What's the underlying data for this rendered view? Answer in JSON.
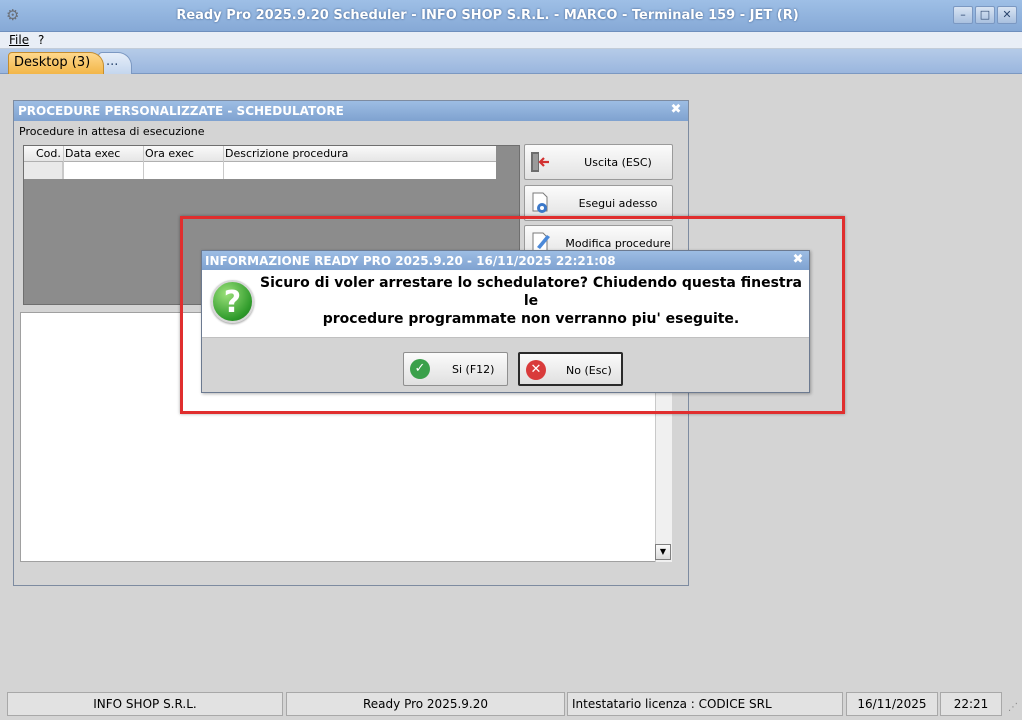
{
  "app": {
    "title": "Ready Pro 2025.9.20 Scheduler  - INFO SHOP S.R.L. - MARCO - Terminale 159 - JET (R)",
    "icon": "gear-icon"
  },
  "window_controls": {
    "minimize": "–",
    "maximize": "□",
    "close": "✕"
  },
  "menu": {
    "items": [
      "File",
      "?"
    ]
  },
  "tabs": [
    {
      "label": "Desktop (3)"
    },
    {
      "label": "..."
    }
  ],
  "procedures_window": {
    "title": "PROCEDURE PERSONALIZZATE - SCHEDULATORE",
    "close": "✖",
    "caption": "Procedure in attesa di esecuzione",
    "columns": [
      "Cod.",
      "Data exec",
      "Ora exec",
      "Descrizione procedura"
    ],
    "buttons": [
      {
        "label": "Uscita (ESC)",
        "icon": "exit-door-icon"
      },
      {
        "label": "Esegui adesso",
        "icon": "run-document-gear-icon"
      },
      {
        "label": "Modifica procedure",
        "icon": "edit-pencil-icon"
      }
    ]
  },
  "dialog": {
    "title": "INFORMAZIONE READY PRO 2025.9.20 - 16/11/2025 22:21:08",
    "close": "✖",
    "icon": "question-icon",
    "icon_glyph": "?",
    "message_line1": "Sicuro di voler arrestare lo schedulatore? Chiudendo questa finestra le",
    "message_line2": "procedure programmate non verranno piu' eseguite.",
    "yes_label": "Si (F12)",
    "no_label": "No (Esc)",
    "yes_glyph": "✓",
    "no_glyph": "✕"
  },
  "status_bar": {
    "company": "INFO SHOP S.R.L.",
    "product": "Ready Pro 2025.9.20",
    "license": "Intestatario licenza : CODICE SRL",
    "date": "16/11/2025",
    "time": "22:21"
  },
  "colors": {
    "highlight": "#e02e2e",
    "titlebar": "#86a9d6",
    "active_tab": "#f2b648",
    "yes_green": "#3aa04a",
    "no_red": "#d93b3b"
  }
}
